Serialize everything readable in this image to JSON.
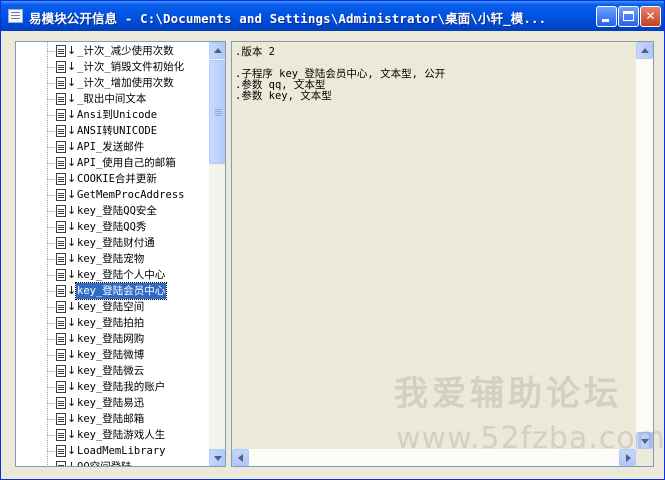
{
  "window": {
    "title": "易模块公开信息 - C:\\Documents and Settings\\Administrator\\桌面\\小轩_模...",
    "minimize_label": "",
    "maximize_label": "",
    "close_label": "✕",
    "icon": "app-window-icon"
  },
  "tree": {
    "items": [
      {
        "label": "_计次_减少使用次数"
      },
      {
        "label": "_计次_销毁文件初始化"
      },
      {
        "label": "_计次_增加使用次数"
      },
      {
        "label": "_取出中间文本"
      },
      {
        "label": "Ansi到Unicode"
      },
      {
        "label": "ANSI转UNICODE"
      },
      {
        "label": "API_发送邮件"
      },
      {
        "label": "API_使用自己的邮箱"
      },
      {
        "label": "COOKIE合并更新"
      },
      {
        "label": "GetMemProcAddress"
      },
      {
        "label": "key_登陆QQ安全"
      },
      {
        "label": "key_登陆QQ秀"
      },
      {
        "label": "key_登陆财付通"
      },
      {
        "label": "key_登陆宠物"
      },
      {
        "label": "key_登陆个人中心"
      },
      {
        "label": "key_登陆会员中心",
        "selected": true
      },
      {
        "label": "key_登陆空间"
      },
      {
        "label": "key_登陆拍拍"
      },
      {
        "label": "key_登陆网购"
      },
      {
        "label": "key_登陆微博"
      },
      {
        "label": "key_登陆微云"
      },
      {
        "label": "key_登陆我的账户"
      },
      {
        "label": "key_登陆易迅"
      },
      {
        "label": "key_登陆邮箱"
      },
      {
        "label": "key_登陆游戏人生"
      },
      {
        "label": "LoadMemLibrary"
      },
      {
        "label": "QQ空间登陆"
      }
    ],
    "item_icon": "document-icon",
    "item_arrow": "↓"
  },
  "code": {
    "lines": [
      ".版本 2",
      "",
      ".子程序 key_登陆会员中心, 文本型, 公开",
      ".参数 qq, 文本型",
      ".参数 key, 文本型"
    ]
  },
  "watermark": {
    "text": "我爱辅助论坛",
    "url": "www.52fzba.com"
  },
  "colors": {
    "titlebar": "#0054e3",
    "selection": "#316ac5",
    "window_bg": "#ece9d8"
  }
}
